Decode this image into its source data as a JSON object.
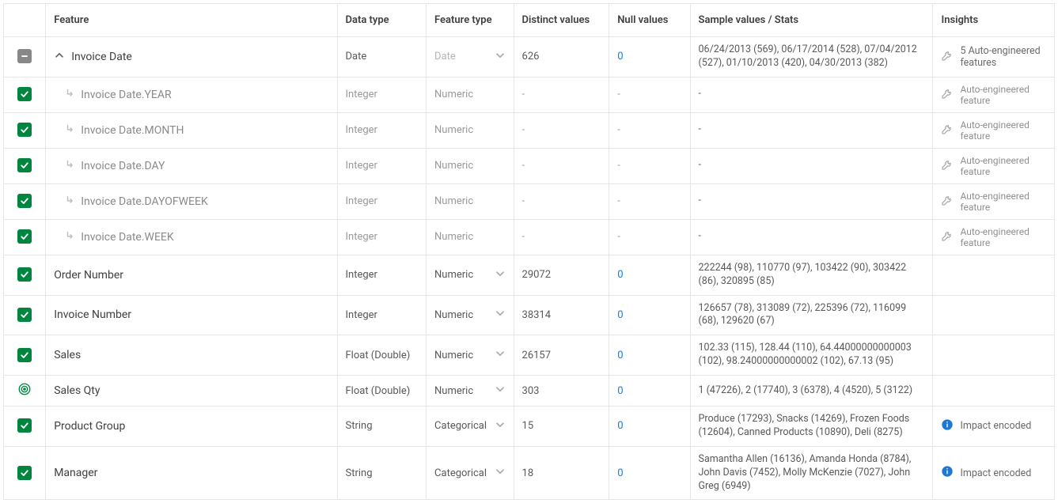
{
  "columns": {
    "feature": "Feature",
    "data_type": "Data type",
    "feature_type": "Feature type",
    "distinct": "Distinct values",
    "null": "Null values",
    "sample": "Sample values / Stats",
    "insights": "Insights"
  },
  "rows": [
    {
      "check": "indet",
      "feature": "Invoice Date",
      "expand": "open",
      "data_type": "Date",
      "feature_type": "Date",
      "ftype_dd": true,
      "ftype_disabled": true,
      "distinct": "626",
      "null": "0",
      "sample": "06/24/2013 (569), 06/17/2014 (528), 07/04/2012 (527), 01/10/2013 (420), 04/30/2013 (382)",
      "insight": "5 Auto-engineered features",
      "insight_icon": "wrench"
    },
    {
      "check": "checked",
      "feature": "Invoice Date.YEAR",
      "sub": true,
      "data_type": "Integer",
      "feature_type": "Numeric",
      "ftype_dd": false,
      "distinct": "-",
      "null": "-",
      "sample": "-",
      "insight": "Auto-engineered feature",
      "insight_icon": "wrench",
      "insight_muted": true
    },
    {
      "check": "checked",
      "feature": "Invoice Date.MONTH",
      "sub": true,
      "data_type": "Integer",
      "feature_type": "Numeric",
      "ftype_dd": false,
      "distinct": "-",
      "null": "-",
      "sample": "-",
      "insight": "Auto-engineered feature",
      "insight_icon": "wrench",
      "insight_muted": true
    },
    {
      "check": "checked",
      "feature": "Invoice Date.DAY",
      "sub": true,
      "data_type": "Integer",
      "feature_type": "Numeric",
      "ftype_dd": false,
      "distinct": "-",
      "null": "-",
      "sample": "-",
      "insight": "Auto-engineered feature",
      "insight_icon": "wrench",
      "insight_muted": true
    },
    {
      "check": "checked",
      "feature": "Invoice Date.DAYOFWEEK",
      "sub": true,
      "data_type": "Integer",
      "feature_type": "Numeric",
      "ftype_dd": false,
      "distinct": "-",
      "null": "-",
      "sample": "-",
      "insight": "Auto-engineered feature",
      "insight_icon": "wrench",
      "insight_muted": true
    },
    {
      "check": "checked",
      "feature": "Invoice Date.WEEK",
      "sub": true,
      "data_type": "Integer",
      "feature_type": "Numeric",
      "ftype_dd": false,
      "distinct": "-",
      "null": "-",
      "sample": "-",
      "insight": "Auto-engineered feature",
      "insight_icon": "wrench",
      "insight_muted": true
    },
    {
      "check": "checked",
      "feature": "Order Number",
      "data_type": "Integer",
      "feature_type": "Numeric",
      "ftype_dd": true,
      "distinct": "29072",
      "null": "0",
      "sample": "222244 (98), 110770 (97), 103422 (90), 303422 (86), 320895 (85)",
      "insight": ""
    },
    {
      "check": "checked",
      "feature": "Invoice Number",
      "data_type": "Integer",
      "feature_type": "Numeric",
      "ftype_dd": true,
      "distinct": "38314",
      "null": "0",
      "sample": "126657 (78), 313089 (72), 225396 (72), 116099 (68), 129620 (67)",
      "insight": ""
    },
    {
      "check": "checked",
      "feature": "Sales",
      "data_type": "Float (Double)",
      "feature_type": "Numeric",
      "ftype_dd": true,
      "distinct": "26157",
      "null": "0",
      "sample": "102.33 (115), 128.44 (110), 64.44000000000003 (102), 98.24000000000002 (102), 67.13 (95)",
      "insight": ""
    },
    {
      "check": "target",
      "feature": "Sales Qty",
      "data_type": "Float (Double)",
      "feature_type": "Numeric",
      "ftype_dd": true,
      "distinct": "303",
      "null": "0",
      "sample": "1 (47226), 2 (17740), 3 (6378), 4 (4520), 5 (3122)",
      "insight": ""
    },
    {
      "check": "checked",
      "feature": "Product Group",
      "data_type": "String",
      "feature_type": "Categorical",
      "ftype_dd": true,
      "distinct": "15",
      "null": "0",
      "sample": "Produce (17293), Snacks (14269), Frozen Foods (12604), Canned Products (10890), Deli (8275)",
      "insight": "Impact encoded",
      "insight_icon": "info"
    },
    {
      "check": "checked",
      "feature": "Manager",
      "data_type": "String",
      "feature_type": "Categorical",
      "ftype_dd": true,
      "distinct": "18",
      "null": "0",
      "sample": "Samantha Allen (16136), Amanda Honda (8784), John Davis (7452), Molly McKenzie (7027), John Greg (6949)",
      "insight": "Impact encoded",
      "insight_icon": "info"
    }
  ]
}
